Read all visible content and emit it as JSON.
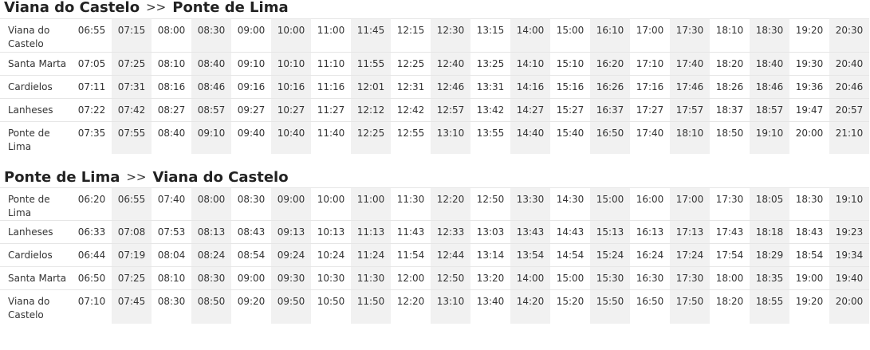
{
  "sections": [
    {
      "from": "Viana do Castelo",
      "sep": ">>",
      "to": "Ponte de Lima",
      "rows": [
        {
          "stop": "Viana do Castelo",
          "times": [
            "06:55",
            "07:15",
            "08:00",
            "08:30",
            "09:00",
            "10:00",
            "11:00",
            "11:45",
            "12:15",
            "12:30",
            "13:15",
            "14:00",
            "15:00",
            "16:10",
            "17:00",
            "17:30",
            "18:10",
            "18:30",
            "19:20",
            "20:30"
          ]
        },
        {
          "stop": "Santa Marta",
          "times": [
            "07:05",
            "07:25",
            "08:10",
            "08:40",
            "09:10",
            "10:10",
            "11:10",
            "11:55",
            "12:25",
            "12:40",
            "13:25",
            "14:10",
            "15:10",
            "16:20",
            "17:10",
            "17:40",
            "18:20",
            "18:40",
            "19:30",
            "20:40"
          ]
        },
        {
          "stop": "Cardielos",
          "times": [
            "07:11",
            "07:31",
            "08:16",
            "08:46",
            "09:16",
            "10:16",
            "11:16",
            "12:01",
            "12:31",
            "12:46",
            "13:31",
            "14:16",
            "15:16",
            "16:26",
            "17:16",
            "17:46",
            "18:26",
            "18:46",
            "19:36",
            "20:46"
          ]
        },
        {
          "stop": "Lanheses",
          "times": [
            "07:22",
            "07:42",
            "08:27",
            "08:57",
            "09:27",
            "10:27",
            "11:27",
            "12:12",
            "12:42",
            "12:57",
            "13:42",
            "14:27",
            "15:27",
            "16:37",
            "17:27",
            "17:57",
            "18:37",
            "18:57",
            "19:47",
            "20:57"
          ]
        },
        {
          "stop": "Ponte de Lima",
          "times": [
            "07:35",
            "07:55",
            "08:40",
            "09:10",
            "09:40",
            "10:40",
            "11:40",
            "12:25",
            "12:55",
            "13:10",
            "13:55",
            "14:40",
            "15:40",
            "16:50",
            "17:40",
            "18:10",
            "18:50",
            "19:10",
            "20:00",
            "21:10"
          ]
        }
      ]
    },
    {
      "from": "Ponte de Lima",
      "sep": ">>",
      "to": "Viana do Castelo",
      "rows": [
        {
          "stop": "Ponte de Lima",
          "times": [
            "06:20",
            "06:55",
            "07:40",
            "08:00",
            "08:30",
            "09:00",
            "10:00",
            "11:00",
            "11:30",
            "12:20",
            "12:50",
            "13:30",
            "14:30",
            "15:00",
            "16:00",
            "17:00",
            "17:30",
            "18:05",
            "18:30",
            "19:10"
          ]
        },
        {
          "stop": "Lanheses",
          "times": [
            "06:33",
            "07:08",
            "07:53",
            "08:13",
            "08:43",
            "09:13",
            "10:13",
            "11:13",
            "11:43",
            "12:33",
            "13:03",
            "13:43",
            "14:43",
            "15:13",
            "16:13",
            "17:13",
            "17:43",
            "18:18",
            "18:43",
            "19:23"
          ]
        },
        {
          "stop": "Cardielos",
          "times": [
            "06:44",
            "07:19",
            "08:04",
            "08:24",
            "08:54",
            "09:24",
            "10:24",
            "11:24",
            "11:54",
            "12:44",
            "13:14",
            "13:54",
            "14:54",
            "15:24",
            "16:24",
            "17:24",
            "17:54",
            "18:29",
            "18:54",
            "19:34"
          ]
        },
        {
          "stop": "Santa Marta",
          "times": [
            "06:50",
            "07:25",
            "08:10",
            "08:30",
            "09:00",
            "09:30",
            "10:30",
            "11:30",
            "12:00",
            "12:50",
            "13:20",
            "14:00",
            "15:00",
            "15:30",
            "16:30",
            "17:30",
            "18:00",
            "18:35",
            "19:00",
            "19:40"
          ]
        },
        {
          "stop": "Viana do Castelo",
          "times": [
            "07:10",
            "07:45",
            "08:30",
            "08:50",
            "09:20",
            "09:50",
            "10:50",
            "11:50",
            "12:20",
            "13:10",
            "13:40",
            "14:20",
            "15:20",
            "15:50",
            "16:50",
            "17:50",
            "18:20",
            "18:55",
            "19:20",
            "20:00"
          ]
        }
      ]
    }
  ]
}
